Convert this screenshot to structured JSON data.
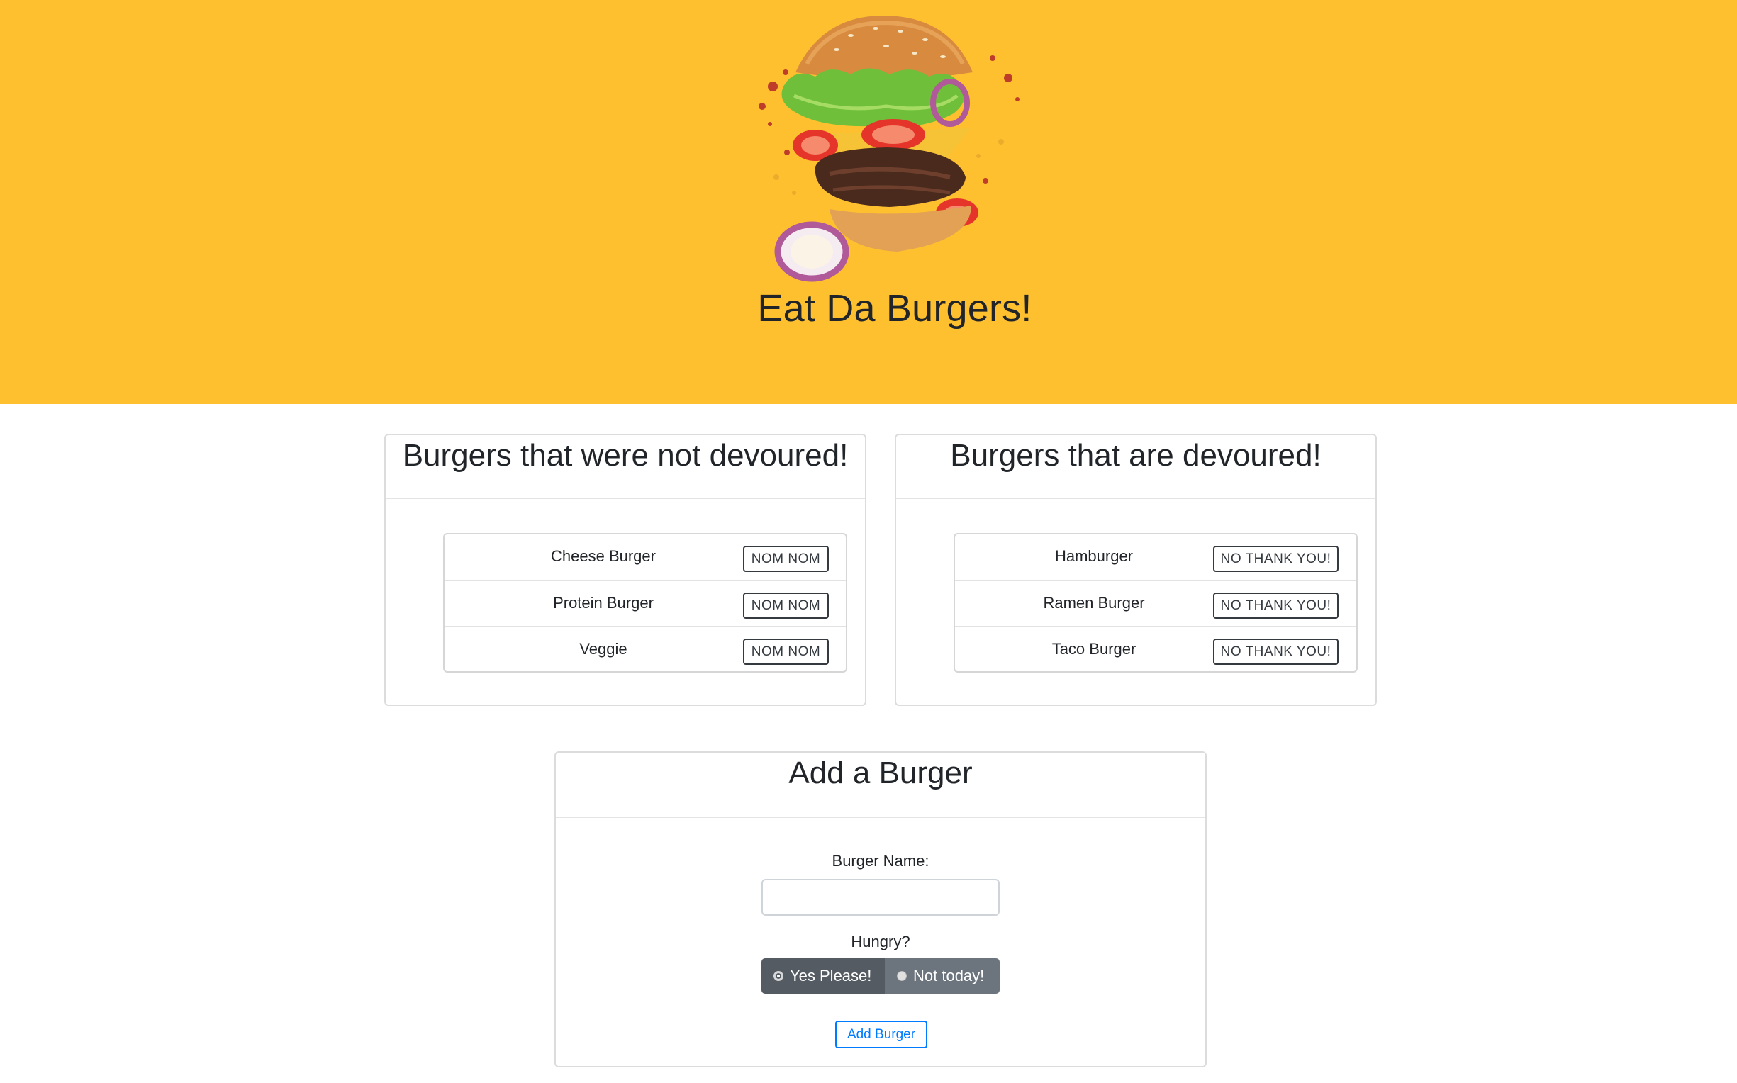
{
  "hero": {
    "title": "Eat Da Burgers!",
    "background_color": "#fec02f",
    "image_icon": "burger-illustration"
  },
  "not_devoured": {
    "heading": "Burgers that were not devoured!",
    "button_label": "NOM NOM",
    "items": [
      {
        "name": "Cheese Burger"
      },
      {
        "name": "Protein Burger"
      },
      {
        "name": "Veggie"
      }
    ]
  },
  "devoured": {
    "heading": "Burgers that are devoured!",
    "button_label": "NO THANK YOU!",
    "items": [
      {
        "name": "Hamburger"
      },
      {
        "name": "Ramen Burger"
      },
      {
        "name": "Taco Burger"
      }
    ]
  },
  "add_form": {
    "heading": "Add a Burger",
    "name_label": "Burger Name:",
    "name_value": "",
    "hungry_label": "Hungry?",
    "option_yes": "Yes Please!",
    "option_no": "Not today!",
    "selected": "Yes Please!",
    "submit_label": "Add Burger",
    "accent_color": "#007bff"
  }
}
